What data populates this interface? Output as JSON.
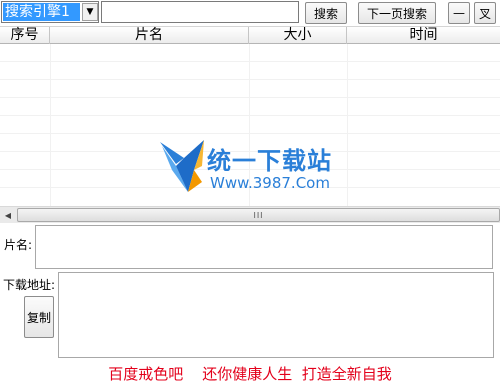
{
  "toolbar": {
    "engine_value": "搜索引擎1",
    "search_value": "",
    "search_label": "搜索",
    "next_page_label": "下一页搜索",
    "minimize_label": "—",
    "close_label": "叉"
  },
  "table": {
    "columns": [
      "序号",
      "片名",
      "大小",
      "时间"
    ],
    "rows": []
  },
  "watermark": {
    "name": "统一下载站",
    "url": "Www.3987.Com"
  },
  "scrollbar": {
    "grip": "III"
  },
  "detail": {
    "name_label": "片名:",
    "name_value": "",
    "url_label": "下载地址:",
    "url_value": "",
    "copy_label": "复制"
  },
  "slogan": "百度戒色吧    还你健康人生  打造全新自我",
  "colors": {
    "selection": "#3399ff",
    "logo_blue": "#2a7fd8",
    "logo_orange": "#f39800",
    "slogan_red": "#e3001b"
  }
}
